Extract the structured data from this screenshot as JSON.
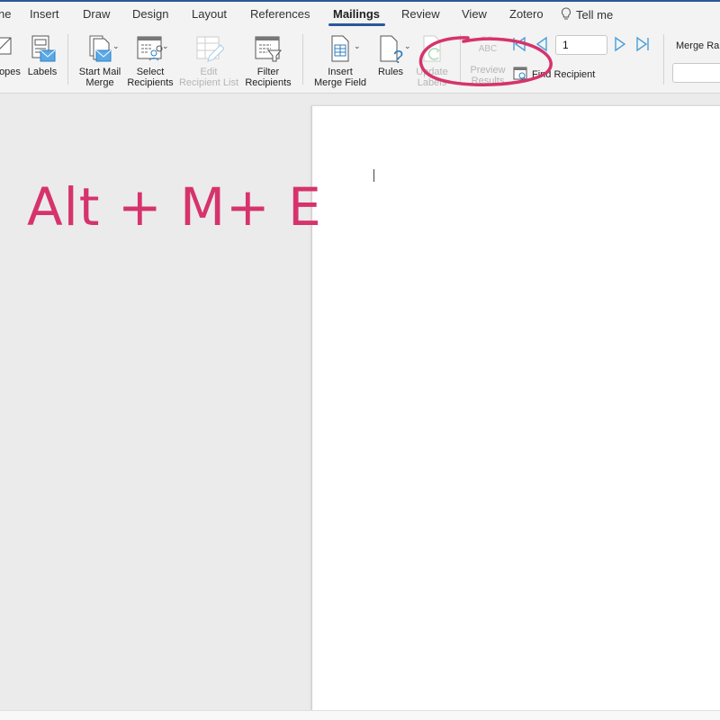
{
  "tabs": [
    {
      "label": "ne",
      "active": false
    },
    {
      "label": "Insert",
      "active": false
    },
    {
      "label": "Draw",
      "active": false
    },
    {
      "label": "Design",
      "active": false
    },
    {
      "label": "Layout",
      "active": false
    },
    {
      "label": "References",
      "active": false
    },
    {
      "label": "Mailings",
      "active": true
    },
    {
      "label": "Review",
      "active": false
    },
    {
      "label": "View",
      "active": false
    },
    {
      "label": "Zotero",
      "active": false
    }
  ],
  "tell_me": {
    "label": "Tell me",
    "icon": "lightbulb-icon"
  },
  "ribbon": {
    "envelopes": {
      "label": "opes",
      "icon": "envelope-icon"
    },
    "labels": {
      "label": "Labels",
      "icon": "labels-icon"
    },
    "start_mail_merge": {
      "line1": "Start Mail",
      "line2": "Merge",
      "icon": "start-mail-merge-icon"
    },
    "select_recipients": {
      "line1": "Select",
      "line2": "Recipients",
      "icon": "select-recipients-icon"
    },
    "edit_recipient_list": {
      "line1": "Edit",
      "line2": "Recipient List",
      "icon": "edit-list-icon",
      "disabled": true
    },
    "filter_recipients": {
      "line1": "Filter",
      "line2": "Recipients",
      "icon": "filter-icon"
    },
    "insert_merge_field": {
      "line1": "Insert",
      "line2": "Merge Field",
      "icon": "merge-field-icon"
    },
    "rules": {
      "label": "Rules",
      "icon": "rules-icon"
    },
    "update_labels": {
      "line1": "Update",
      "line2": "Labels",
      "icon": "update-labels-icon",
      "disabled": true
    },
    "preview_results": {
      "line1": "Preview",
      "line2": "Results",
      "glyph": "ABC",
      "icon": "preview-results-icon",
      "disabled": true
    },
    "record_number": "1",
    "find_recipient": {
      "label": "Find Recipient",
      "icon": "find-recipient-icon"
    },
    "merge_range": {
      "label": "Merge Ran",
      "value": ""
    }
  },
  "overlay": {
    "shortcut_text": "Alt + M+ E",
    "color": "#d6336c"
  }
}
